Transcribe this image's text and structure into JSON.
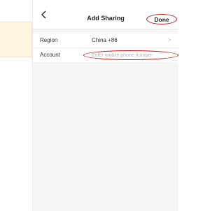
{
  "nav": {
    "title": "Add Sharing",
    "done_label": "Done",
    "back_icon": "chevron-left-icon"
  },
  "form": {
    "region_label": "Region",
    "region_value": "China +86",
    "region_chevron": ">",
    "account_label": "Account",
    "account_placeholder": "Enter mobile phone number",
    "account_value": ""
  },
  "colors": {
    "highlight": "#c81414",
    "banner": "#fdf4dc",
    "background": "#f5f5f5"
  }
}
